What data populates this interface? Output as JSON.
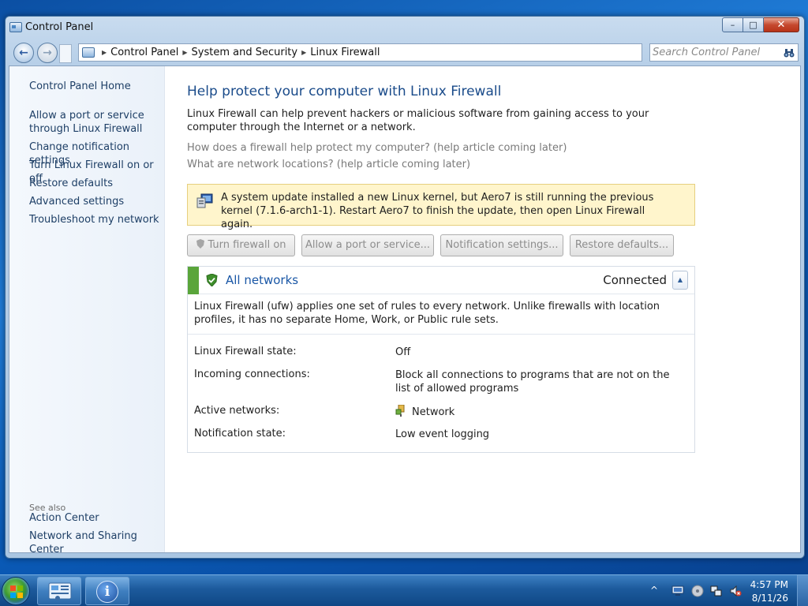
{
  "window": {
    "title": "Control Panel",
    "controls": {
      "minimize": "–",
      "maximize": "□",
      "close": "✕"
    }
  },
  "navigation": {
    "back": "←",
    "forward": "→",
    "breadcrumbs": [
      "Control Panel",
      "System and Security",
      "Linux Firewall"
    ],
    "search_placeholder": "Search Control Panel"
  },
  "sidebar": {
    "home": "Control Panel Home",
    "links": [
      "Allow a port or service through Linux Firewall",
      "Change notification settings",
      "Turn Linux Firewall on or off",
      "Restore defaults",
      "Advanced settings",
      "Troubleshoot my network"
    ],
    "see_also_heading": "See also",
    "see_also": [
      "Action Center",
      "Network and Sharing Center"
    ]
  },
  "main": {
    "title": "Help protect your computer with Linux Firewall",
    "intro": "Linux Firewall can help prevent hackers or malicious software from gaining access to your computer through the Internet or a network.",
    "help_links": [
      "How does a firewall help protect my computer?  (help article coming later)",
      "What are network locations?  (help article coming later)"
    ],
    "banner": "A system update installed a new Linux kernel, but Aero7 is still running the previous kernel (7.1.6-arch1-1). Restart Aero7 to finish the update, then open Linux Firewall again.",
    "buttons": {
      "turn_on": "Turn firewall on",
      "allow_port": "Allow a port or service...",
      "notifications": "Notification settings...",
      "restore": "Restore defaults..."
    },
    "panel": {
      "title": "All networks",
      "status": "Connected",
      "collapse": "▲",
      "description": "Linux Firewall (ufw) applies one set of rules to every network. Unlike firewalls with location profiles, it has no separate Home, Work, or Public rule sets.",
      "rows": [
        {
          "label": "Linux Firewall state:",
          "value": "Off"
        },
        {
          "label": "Incoming connections:",
          "value": "Block all connections to programs that are not on the list of allowed programs"
        },
        {
          "label": "Active networks:",
          "value": "Network"
        },
        {
          "label": "Notification state:",
          "value": "Low event logging"
        }
      ]
    }
  },
  "taskbar": {
    "info_glyph": "i",
    "tray_arrow": "^",
    "time": "4:57 PM",
    "date": "8/11/26"
  },
  "colors": {
    "accent_link": "#1e3f66",
    "title_blue": "#1a4b8a",
    "status_green": "#5aa53a",
    "banner_bg": "#fff5cc"
  },
  "icons": {
    "window": "control-panel-icon",
    "search": "binoculars-icon",
    "banner": "computer-warning-icon",
    "panel": "green-shield-check-icon",
    "network": "network-icon"
  }
}
